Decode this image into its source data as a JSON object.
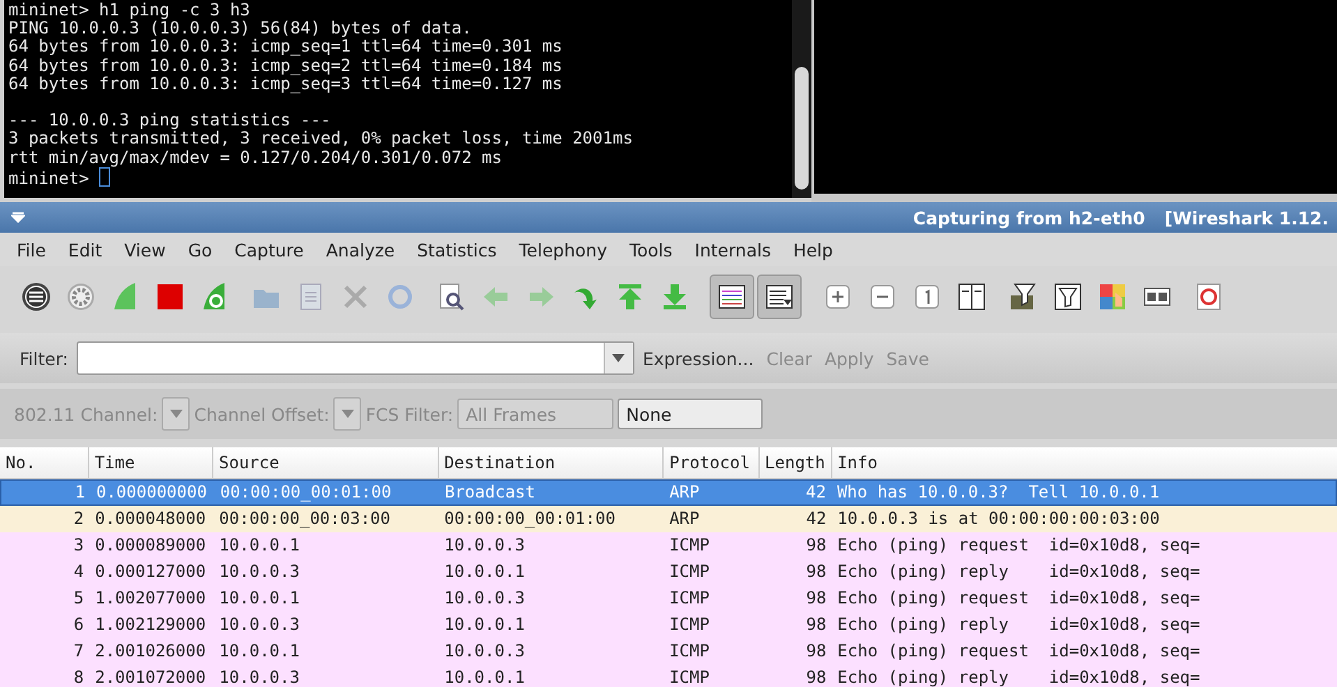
{
  "terminal": {
    "lines": [
      "mininet> h1 ping -c 3 h3",
      "PING 10.0.0.3 (10.0.0.3) 56(84) bytes of data.",
      "64 bytes from 10.0.0.3: icmp_seq=1 ttl=64 time=0.301 ms",
      "64 bytes from 10.0.0.3: icmp_seq=2 ttl=64 time=0.184 ms",
      "64 bytes from 10.0.0.3: icmp_seq=3 ttl=64 time=0.127 ms"
    ],
    "summary": [
      "--- 10.0.0.3 ping statistics ---",
      "3 packets transmitted, 3 received, 0% packet loss, time 2001ms",
      "rtt min/avg/max/mdev = 0.127/0.204/0.301/0.072 ms"
    ],
    "prompt": "mininet>"
  },
  "window": {
    "title": "Capturing from h2-eth0",
    "app": "[Wireshark 1.12."
  },
  "menu": [
    "File",
    "Edit",
    "View",
    "Go",
    "Capture",
    "Analyze",
    "Statistics",
    "Telephony",
    "Tools",
    "Internals",
    "Help"
  ],
  "filter": {
    "label": "Filter:",
    "actions": [
      {
        "label": "Expression...",
        "disabled": false
      },
      {
        "label": "Clear",
        "disabled": true
      },
      {
        "label": "Apply",
        "disabled": true
      },
      {
        "label": "Save",
        "disabled": true
      }
    ]
  },
  "wireless": {
    "channel_label": "802.11 Channel:",
    "offset_label": "Channel Offset:",
    "fcs_label": "FCS Filter:",
    "fcs_value": "All Frames",
    "decrypt_value": "None"
  },
  "table": {
    "columns": [
      "No.",
      "Time",
      "Source",
      "Destination",
      "Protocol",
      "Length",
      "Info"
    ],
    "rows": [
      {
        "cells": [
          "1",
          "0.000000000",
          "00:00:00_00:01:00",
          "Broadcast",
          "ARP",
          "42",
          "Who has 10.0.0.3?  Tell 10.0.0.1"
        ],
        "selected": true,
        "color": "#4a8de0"
      },
      {
        "cells": [
          "2",
          "0.000048000",
          "00:00:00_00:03:00",
          "00:00:00_00:01:00",
          "ARP",
          "42",
          "10.0.0.3 is at 00:00:00:00:03:00"
        ],
        "selected": false,
        "color": "#faf0d7"
      },
      {
        "cells": [
          "3",
          "0.000089000",
          "10.0.0.1",
          "10.0.0.3",
          "ICMP",
          "98",
          "Echo (ping) request  id=0x10d8, seq="
        ],
        "selected": false,
        "color": "#fce0ff"
      },
      {
        "cells": [
          "4",
          "0.000127000",
          "10.0.0.3",
          "10.0.0.1",
          "ICMP",
          "98",
          "Echo (ping) reply    id=0x10d8, seq="
        ],
        "selected": false,
        "color": "#fce0ff"
      },
      {
        "cells": [
          "5",
          "1.002077000",
          "10.0.0.1",
          "10.0.0.3",
          "ICMP",
          "98",
          "Echo (ping) request  id=0x10d8, seq="
        ],
        "selected": false,
        "color": "#fce0ff"
      },
      {
        "cells": [
          "6",
          "1.002129000",
          "10.0.0.3",
          "10.0.0.1",
          "ICMP",
          "98",
          "Echo (ping) reply    id=0x10d8, seq="
        ],
        "selected": false,
        "color": "#fce0ff"
      },
      {
        "cells": [
          "7",
          "2.001026000",
          "10.0.0.1",
          "10.0.0.3",
          "ICMP",
          "98",
          "Echo (ping) request  id=0x10d8, seq="
        ],
        "selected": false,
        "color": "#fce0ff"
      },
      {
        "cells": [
          "8",
          "2.001072000",
          "10.0.0.3",
          "10.0.0.1",
          "ICMP",
          "98",
          "Echo (ping) reply    id=0x10d8, seq="
        ],
        "selected": false,
        "color": "#fce0ff"
      }
    ]
  }
}
